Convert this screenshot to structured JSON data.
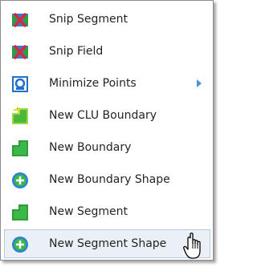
{
  "menu": {
    "items": [
      {
        "label": "Snip Segment",
        "icon": "snip-segment-icon"
      },
      {
        "label": "Snip Field",
        "icon": "snip-field-icon"
      },
      {
        "label": "Minimize Points",
        "icon": "minimize-points-icon",
        "has_submenu": true
      },
      {
        "label": "New CLU Boundary",
        "icon": "new-clu-boundary-icon"
      },
      {
        "label": "New Boundary",
        "icon": "new-boundary-icon"
      },
      {
        "label": "New Boundary Shape",
        "icon": "new-boundary-shape-icon"
      },
      {
        "label": "New Segment",
        "icon": "new-segment-icon"
      },
      {
        "label": "New Segment Shape",
        "icon": "new-segment-shape-icon",
        "hovered": true
      }
    ]
  },
  "colors": {
    "icon_green": "#2e9e3a",
    "icon_red": "#d8283a",
    "icon_blue": "#1f6fcf",
    "hover_bg": "#eaf0f6",
    "submenu_arrow": "#4f8fd6"
  }
}
